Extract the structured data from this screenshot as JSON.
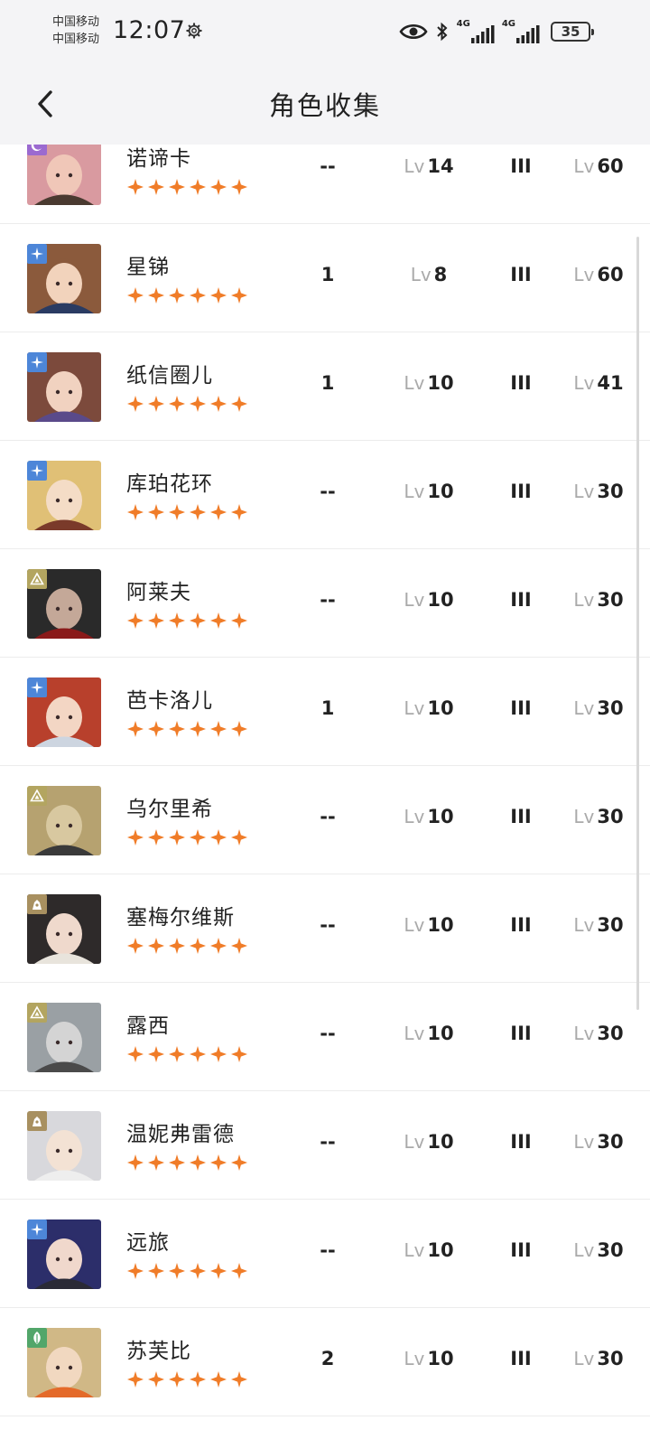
{
  "statusbar": {
    "carrier1": "中国移动",
    "carrier2": "中国移动",
    "time": "12:07",
    "net1": "4G",
    "net2": "4G",
    "battery": "35"
  },
  "navbar": {
    "title": "角色收集"
  },
  "colors": {
    "star": "#f07c28",
    "badge_purple": "#9b6ad0",
    "badge_blue": "#4d86d8",
    "badge_olive": "#b3a560",
    "badge_tan": "#a89060",
    "badge_green": "#52a66a"
  },
  "characters": [
    {
      "name": "诺谛卡",
      "rarity": 6,
      "element": "moon-icon",
      "dupes": "--",
      "lv_prefix": "Lv",
      "level": "14",
      "insight": "III",
      "lv2_prefix": "Lv",
      "max_level": "60"
    },
    {
      "name": "星锑",
      "rarity": 6,
      "element": "star-icon",
      "dupes": "1",
      "lv_prefix": "Lv",
      "level": "8",
      "insight": "III",
      "lv2_prefix": "Lv",
      "max_level": "60"
    },
    {
      "name": "纸信圈儿",
      "rarity": 6,
      "element": "star-icon",
      "dupes": "1",
      "lv_prefix": "Lv",
      "level": "10",
      "insight": "III",
      "lv2_prefix": "Lv",
      "max_level": "41"
    },
    {
      "name": "库珀花环",
      "rarity": 6,
      "element": "star-icon",
      "dupes": "--",
      "lv_prefix": "Lv",
      "level": "10",
      "insight": "III",
      "lv2_prefix": "Lv",
      "max_level": "30"
    },
    {
      "name": "阿莱夫",
      "rarity": 6,
      "element": "mineral-icon",
      "dupes": "--",
      "lv_prefix": "Lv",
      "level": "10",
      "insight": "III",
      "lv2_prefix": "Lv",
      "max_level": "30"
    },
    {
      "name": "芭卡洛儿",
      "rarity": 6,
      "element": "star-icon",
      "dupes": "1",
      "lv_prefix": "Lv",
      "level": "10",
      "insight": "III",
      "lv2_prefix": "Lv",
      "max_level": "30"
    },
    {
      "name": "乌尔里希",
      "rarity": 6,
      "element": "mineral-icon",
      "dupes": "--",
      "lv_prefix": "Lv",
      "level": "10",
      "insight": "III",
      "lv2_prefix": "Lv",
      "max_level": "30"
    },
    {
      "name": "塞梅尔维斯",
      "rarity": 6,
      "element": "beast-icon",
      "dupes": "--",
      "lv_prefix": "Lv",
      "level": "10",
      "insight": "III",
      "lv2_prefix": "Lv",
      "max_level": "30"
    },
    {
      "name": "露西",
      "rarity": 6,
      "element": "mineral-icon",
      "dupes": "--",
      "lv_prefix": "Lv",
      "level": "10",
      "insight": "III",
      "lv2_prefix": "Lv",
      "max_level": "30"
    },
    {
      "name": "温妮弗雷德",
      "rarity": 6,
      "element": "beast-icon",
      "dupes": "--",
      "lv_prefix": "Lv",
      "level": "10",
      "insight": "III",
      "lv2_prefix": "Lv",
      "max_level": "30"
    },
    {
      "name": "远旅",
      "rarity": 6,
      "element": "star-icon",
      "dupes": "--",
      "lv_prefix": "Lv",
      "level": "10",
      "insight": "III",
      "lv2_prefix": "Lv",
      "max_level": "30"
    },
    {
      "name": "苏芙比",
      "rarity": 6,
      "element": "plant-icon",
      "dupes": "2",
      "lv_prefix": "Lv",
      "level": "10",
      "insight": "III",
      "lv2_prefix": "Lv",
      "max_level": "30"
    }
  ]
}
